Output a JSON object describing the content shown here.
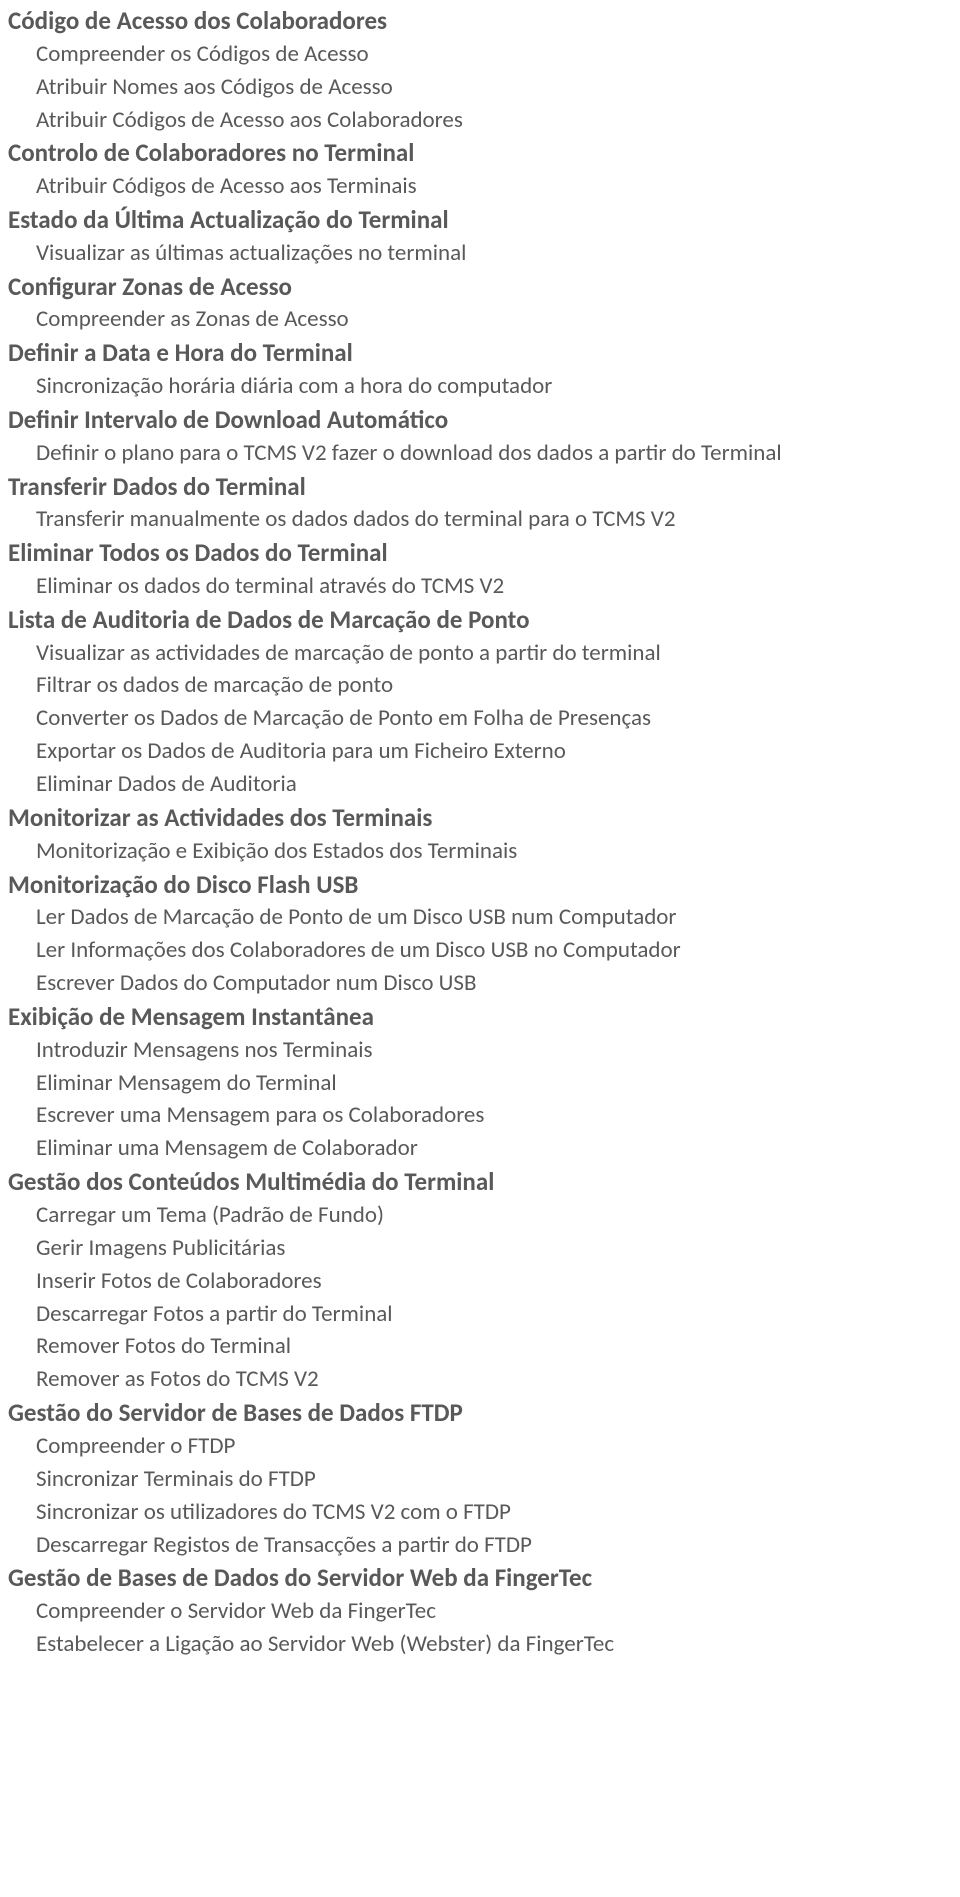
{
  "entries": [
    {
      "level": "heading",
      "text": "Código de Acesso dos Colaboradores"
    },
    {
      "level": "sub",
      "text": "Compreender os Códigos de Acesso"
    },
    {
      "level": "sub",
      "text": "Atribuir Nomes aos Códigos de Acesso"
    },
    {
      "level": "sub",
      "text": "Atribuir Códigos de Acesso aos Colaboradores"
    },
    {
      "level": "heading",
      "text": "Controlo de Colaboradores no Terminal"
    },
    {
      "level": "sub",
      "text": "Atribuir Códigos de Acesso aos Terminais"
    },
    {
      "level": "heading",
      "text": "Estado da Última Actualização do Terminal"
    },
    {
      "level": "sub",
      "text": "Visualizar as últimas actualizações no terminal"
    },
    {
      "level": "heading",
      "text": "Configurar Zonas de Acesso"
    },
    {
      "level": "sub",
      "text": "Compreender as Zonas de Acesso"
    },
    {
      "level": "heading",
      "text": "Definir a Data e Hora do Terminal"
    },
    {
      "level": "sub",
      "text": "Sincronização horária diária com a hora do computador"
    },
    {
      "level": "heading",
      "text": "Definir Intervalo de Download Automático"
    },
    {
      "level": "sub",
      "text": "Definir o plano para o TCMS V2 fazer o download dos dados a partir do Terminal"
    },
    {
      "level": "heading",
      "text": "Transferir Dados do Terminal"
    },
    {
      "level": "sub",
      "text": "Transferir manualmente os dados dados do terminal para o TCMS V2"
    },
    {
      "level": "heading",
      "text": "Eliminar Todos os Dados do Terminal"
    },
    {
      "level": "sub",
      "text": "Eliminar os dados do terminal através do TCMS V2"
    },
    {
      "level": "heading",
      "text": "Lista de Auditoria de Dados de Marcação de Ponto"
    },
    {
      "level": "sub",
      "text": "Visualizar as actividades de marcação de ponto a partir do terminal"
    },
    {
      "level": "sub",
      "text": "Filtrar os dados de marcação de ponto"
    },
    {
      "level": "sub",
      "text": "Converter os Dados de Marcação de Ponto em Folha de Presenças"
    },
    {
      "level": "sub",
      "text": "Exportar os Dados de Auditoria para um Ficheiro Externo"
    },
    {
      "level": "sub",
      "text": "Eliminar Dados de Auditoria"
    },
    {
      "level": "heading",
      "text": "Monitorizar as Actividades dos Terminais"
    },
    {
      "level": "sub",
      "text": "Monitorização e Exibição dos Estados dos Terminais"
    },
    {
      "level": "heading",
      "text": "Monitorização do Disco Flash USB"
    },
    {
      "level": "sub",
      "text": "Ler Dados de Marcação de Ponto de um Disco USB num Computador"
    },
    {
      "level": "sub",
      "text": "Ler Informações dos Colaboradores de um Disco USB no Computador"
    },
    {
      "level": "sub",
      "text": "Escrever Dados do Computador num Disco USB"
    },
    {
      "level": "heading",
      "text": "Exibição de Mensagem Instantânea"
    },
    {
      "level": "sub",
      "text": "Introduzir Mensagens nos Terminais"
    },
    {
      "level": "sub",
      "text": "Eliminar Mensagem do Terminal"
    },
    {
      "level": "sub",
      "text": "Escrever uma Mensagem para os Colaboradores"
    },
    {
      "level": "sub",
      "text": "Eliminar uma Mensagem de Colaborador"
    },
    {
      "level": "heading",
      "text": "Gestão dos Conteúdos Multimédia do Terminal"
    },
    {
      "level": "sub",
      "text": "Carregar um Tema (Padrão de Fundo)"
    },
    {
      "level": "sub",
      "text": "Gerir Imagens Publicitárias"
    },
    {
      "level": "sub",
      "text": "Inserir Fotos de Colaboradores"
    },
    {
      "level": "sub",
      "text": "Descarregar Fotos a partir do Terminal"
    },
    {
      "level": "sub",
      "text": "Remover Fotos do Terminal"
    },
    {
      "level": "sub",
      "text": "Remover as Fotos do TCMS V2"
    },
    {
      "level": "heading",
      "text": "Gestão do Servidor de Bases de Dados FTDP"
    },
    {
      "level": "sub",
      "text": "Compreender o FTDP"
    },
    {
      "level": "sub",
      "text": "Sincronizar Terminais do FTDP"
    },
    {
      "level": "sub",
      "text": "Sincronizar os utilizadores do TCMS V2 com o FTDP"
    },
    {
      "level": "sub",
      "text": "Descarregar Registos de Transacções a partir do FTDP"
    },
    {
      "level": "heading",
      "text": "Gestão de Bases de Dados do Servidor Web da FingerTec"
    },
    {
      "level": "sub",
      "text": "Compreender o Servidor Web da FingerTec"
    },
    {
      "level": "sub",
      "text": "Estabelecer a Ligação ao Servidor Web (Webster) da FingerTec"
    }
  ]
}
